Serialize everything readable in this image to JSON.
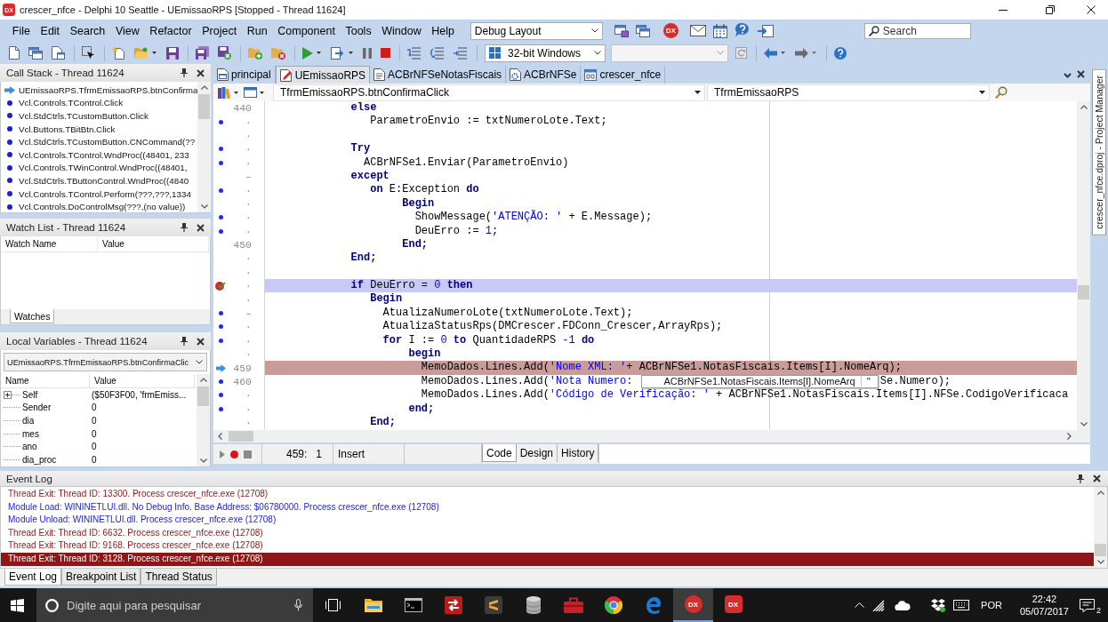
{
  "window": {
    "logo": "DX",
    "title": "crescer_nfce - Delphi 10 Seattle - UEmissaoRPS [Stopped - Thread 11624]"
  },
  "menu": [
    "File",
    "Edit",
    "Search",
    "View",
    "Refactor",
    "Project",
    "Run",
    "Component",
    "Tools",
    "Window",
    "Help"
  ],
  "toolbar": {
    "layout": "Debug Layout",
    "logo": "DX",
    "search": {
      "placeholder": "Search"
    },
    "platform": "32-bit Windows"
  },
  "call_stack": {
    "title": "Call Stack - Thread 11624",
    "frames": [
      {
        "text": "UEmissaoRPS.TfrmEmissaoRPS.btnConfirma",
        "current": true
      },
      {
        "text": "Vcl.Controls.TControl.Click",
        "current": false
      },
      {
        "text": "Vcl.StdCtrls.TCustomButton.Click",
        "current": false
      },
      {
        "text": "Vcl.Buttons.TBitBtn.Click",
        "current": false
      },
      {
        "text": "Vcl.StdCtrls.TCustomButton.CNCommand(??",
        "current": false
      },
      {
        "text": "Vcl.Controls.TControl.WndProc((48401, 233",
        "current": false
      },
      {
        "text": "Vcl.Controls.TWinControl.WndProc((48401,",
        "current": false
      },
      {
        "text": "Vcl.StdCtrls.TButtonControl.WndProc((4840",
        "current": false
      },
      {
        "text": "Vcl.Controls.TControl.Perform(???,???,1334",
        "current": false
      },
      {
        "text": "Vcl.Controls.DoControlMsg(???,(no value))",
        "current": false
      }
    ]
  },
  "watch_list": {
    "title": "Watch List - Thread 11624",
    "columns": [
      "Watch Name",
      "Value"
    ],
    "tabs": [
      {
        "label": "Watches",
        "selected": true
      }
    ]
  },
  "local_variables": {
    "title": "Local Variables - Thread 11624",
    "scope": "UEmissaoRPS.TfrmEmissaoRPS.btnConfirmaClic",
    "columns": [
      "Name",
      "Value"
    ],
    "rows": [
      {
        "name": "Self",
        "value": "($50F3F00, 'frmEmiss...",
        "expanded": false
      },
      {
        "name": "Sender",
        "value": "0"
      },
      {
        "name": "dia",
        "value": "0"
      },
      {
        "name": "mes",
        "value": "0"
      },
      {
        "name": "ano",
        "value": "0"
      },
      {
        "name": "dia_proc",
        "value": "0"
      }
    ]
  },
  "editor": {
    "tabs": [
      {
        "label": "principal",
        "kind": "form",
        "selected": false
      },
      {
        "label": "UEmissaoRPS",
        "kind": "edited",
        "selected": true
      },
      {
        "label": "ACBrNFSeNotasFiscais",
        "kind": "unit",
        "selected": false
      },
      {
        "label": "ACBrNFSe",
        "kind": "component",
        "selected": false
      },
      {
        "label": "crescer_nfce",
        "kind": "project",
        "selected": false
      }
    ],
    "method_dropdown": "TfrmEmissaoRPS.btnConfirmaClick",
    "class_dropdown": "TfrmEmissaoRPS",
    "lines": [
      {
        "gutter": "440",
        "dot": false,
        "breakpoint": false,
        "execution_point": false,
        "tokens": [
          {
            "text": "             else",
            "kind": "keyword"
          }
        ]
      },
      {
        "gutter": "·",
        "dot": true,
        "breakpoint": false,
        "execution_point": false,
        "tokens": [
          {
            "text": "                ParametroEnvio := txtNumeroLote.Text;",
            "kind": "plain"
          }
        ]
      },
      {
        "gutter": "·",
        "dot": false,
        "breakpoint": false,
        "execution_point": false
      },
      {
        "gutter": "·",
        "dot": true,
        "breakpoint": false,
        "execution_point": false,
        "tokens": [
          {
            "text": "             Try",
            "kind": "keyword"
          }
        ]
      },
      {
        "gutter": "·",
        "dot": true,
        "breakpoint": false,
        "execution_point": false,
        "tokens": [
          {
            "text": "               ACBrNFSe1.Enviar(ParametroEnvio)",
            "kind": "plain"
          }
        ]
      },
      {
        "gutter": "–",
        "dot": false,
        "breakpoint": false,
        "execution_point": false,
        "tokens": [
          {
            "text": "             except",
            "kind": "keyword"
          }
        ]
      },
      {
        "gutter": "·",
        "dot": true,
        "breakpoint": false,
        "execution_point": false,
        "tokens": [
          {
            "text": "                on",
            "kind": "keyword"
          },
          {
            "text": " E:Exception ",
            "kind": "plain"
          },
          {
            "text": "do",
            "kind": "keyword"
          }
        ]
      },
      {
        "gutter": "·",
        "dot": false,
        "breakpoint": false,
        "execution_point": false,
        "tokens": [
          {
            "text": "                     Begin",
            "kind": "keyword"
          }
        ]
      },
      {
        "gutter": "·",
        "dot": true,
        "breakpoint": false,
        "execution_point": false,
        "tokens": [
          {
            "text": "                       ShowMessage(",
            "kind": "plain"
          },
          {
            "text": "'ATENÇÃO: '",
            "kind": "string"
          },
          {
            "text": " + E.Message);",
            "kind": "plain"
          }
        ]
      },
      {
        "gutter": "·",
        "dot": true,
        "breakpoint": false,
        "execution_point": false,
        "tokens": [
          {
            "text": "                       DeuErro := ",
            "kind": "plain"
          },
          {
            "text": "1",
            "kind": "number"
          },
          {
            "text": ";",
            "kind": "plain"
          }
        ]
      },
      {
        "gutter": "450",
        "dot": false,
        "breakpoint": false,
        "execution_point": false,
        "tokens": [
          {
            "text": "                     End;",
            "kind": "keyword"
          }
        ]
      },
      {
        "gutter": "·",
        "dot": false,
        "breakpoint": false,
        "execution_point": false,
        "tokens": [
          {
            "text": "             End;",
            "kind": "keyword"
          }
        ]
      },
      {
        "gutter": "·",
        "dot": false,
        "breakpoint": false,
        "execution_point": false
      },
      {
        "gutter": "·",
        "dot": false,
        "breakpoint": true,
        "execution_point": false,
        "tokens": [
          {
            "text": "             if",
            "kind": "keyword"
          },
          {
            "text": " DeuErro = ",
            "kind": "plain"
          },
          {
            "text": "0",
            "kind": "number"
          },
          {
            "text": " then",
            "kind": "keyword"
          }
        ]
      },
      {
        "gutter": "·",
        "dot": false,
        "breakpoint": false,
        "execution_point": false,
        "tokens": [
          {
            "text": "                Begin",
            "kind": "keyword"
          }
        ]
      },
      {
        "gutter": "–",
        "dot": true,
        "breakpoint": false,
        "execution_point": false,
        "tokens": [
          {
            "text": "                  AtualizaNumeroLote(txtNumeroLote.Text);",
            "kind": "plain"
          }
        ]
      },
      {
        "gutter": "·",
        "dot": true,
        "breakpoint": false,
        "execution_point": false,
        "tokens": [
          {
            "text": "                  AtualizaStatusRps(DMCrescer.FDConn_Crescer,ArrayRps);",
            "kind": "plain"
          }
        ]
      },
      {
        "gutter": "·",
        "dot": true,
        "breakpoint": false,
        "execution_point": false,
        "tokens": [
          {
            "text": "                  for",
            "kind": "keyword"
          },
          {
            "text": " I := ",
            "kind": "plain"
          },
          {
            "text": "0",
            "kind": "number"
          },
          {
            "text": " to",
            "kind": "keyword"
          },
          {
            "text": " QuantidadeRPS ",
            "kind": "plain"
          },
          {
            "text": "-1",
            "kind": "number"
          },
          {
            "text": " do",
            "kind": "keyword"
          }
        ]
      },
      {
        "gutter": "·",
        "dot": false,
        "breakpoint": false,
        "execution_point": false,
        "tokens": [
          {
            "text": "                      begin",
            "kind": "keyword"
          }
        ]
      },
      {
        "gutter": "459",
        "dot": false,
        "breakpoint": false,
        "execution_point": true,
        "tokens": [
          {
            "text": "                        MemoDados.Lines.Add(",
            "kind": "plain"
          },
          {
            "text": "'Nome XML: '",
            "kind": "string"
          },
          {
            "text": "+ ACBrNFSe1.NotasFiscais.Items[I].NomeArq);",
            "kind": "plain"
          }
        ]
      },
      {
        "gutter": "460",
        "dot": true,
        "breakpoint": false,
        "execution_point": false,
        "tokens": [
          {
            "text": "                        MemoDados.Lines.Add(",
            "kind": "plain"
          },
          {
            "text": "'Nota Numero:",
            "kind": "string"
          }
        ],
        "tooltip": {
          "expression": "ACBrNFSe1.NotasFiscais.Items[I].NomeArq",
          "value": "''"
        },
        "tail": [
          {
            "text": "Se.Numero);",
            "kind": "plain"
          }
        ]
      },
      {
        "gutter": "·",
        "dot": true,
        "breakpoint": false,
        "execution_point": false,
        "tokens": [
          {
            "text": "                        MemoDados.Lines.Add(",
            "kind": "plain"
          },
          {
            "text": "'Código de Verificação: '",
            "kind": "string"
          },
          {
            "text": " + ACBrNFSe1.NotasFiscais.Items[I].NFSe.CodigoVerificaca",
            "kind": "plain"
          }
        ]
      },
      {
        "gutter": "·",
        "dot": true,
        "breakpoint": false,
        "execution_point": false,
        "tokens": [
          {
            "text": "                      end;",
            "kind": "keyword"
          }
        ]
      },
      {
        "gutter": "·",
        "dot": false,
        "breakpoint": false,
        "execution_point": false,
        "tokens": [
          {
            "text": "                End;",
            "kind": "keyword"
          }
        ]
      }
    ],
    "status": {
      "position": "459:   1",
      "mode": "Insert"
    },
    "view_tabs": [
      {
        "label": "Code",
        "selected": true
      },
      {
        "label": "Design",
        "selected": false
      },
      {
        "label": "History",
        "selected": false
      }
    ]
  },
  "project_manager_tab": "crescer_nfce.dproj - Project Manager",
  "event_log": {
    "title": "Event Log",
    "entries": [
      {
        "text": "Thread Exit: Thread ID: 13300. Process crescer_nfce.exe (12708)",
        "color": "#8f1616",
        "selected": false
      },
      {
        "text": "Module Load: WININETLUI.dll. No Debug Info. Base Address: $06780000. Process crescer_nfce.exe (12708)",
        "color": "#2424d8",
        "selected": false
      },
      {
        "text": "Module Unload: WININETLUI.dll. Process crescer_nfce.exe (12708)",
        "color": "#2424d8",
        "selected": false
      },
      {
        "text": "Thread Exit: Thread ID: 6632. Process crescer_nfce.exe (12708)",
        "color": "#8f1616",
        "selected": false
      },
      {
        "text": "Thread Exit: Thread ID: 9168. Process crescer_nfce.exe (12708)",
        "color": "#8f1616",
        "selected": false
      },
      {
        "text": "Thread Exit: Thread ID: 3128. Process crescer_nfce.exe (12708)",
        "color": "#8f1616",
        "selected": true
      }
    ],
    "tabs": [
      {
        "label": "Event Log",
        "selected": true
      },
      {
        "label": "Breakpoint List",
        "selected": false
      },
      {
        "label": "Thread Status",
        "selected": false
      }
    ]
  },
  "taskbar": {
    "search": {
      "placeholder": "Digite aqui para pesquisar"
    },
    "apps": [
      {
        "logo": "DX",
        "selected": true
      },
      {
        "logo": "DX",
        "selected": false
      }
    ],
    "language": "POR",
    "time": "22:42",
    "date": "05/07/2017",
    "notifications": "2"
  }
}
